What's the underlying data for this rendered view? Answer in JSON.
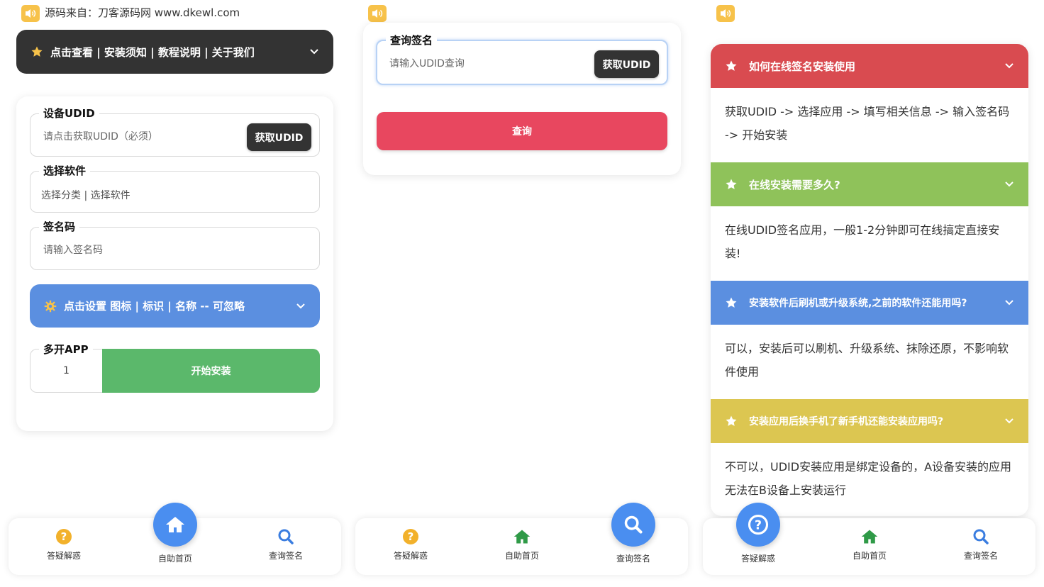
{
  "colors": {
    "dark": "#333333",
    "blue": "#5b8fe0",
    "green": "#5bb86b",
    "pink": "#e8475f",
    "red": "#d94b50",
    "lime": "#8fc25a",
    "yellow": "#dcc651",
    "nav_blue": "#4a8ef0",
    "orange": "#f2b12b"
  },
  "panel1": {
    "notice": "源码来自：刀客源码网 www.dkewl.com",
    "menu_bar": "点击查看 | 安装须知 | 教程说明 | 关于我们",
    "udid": {
      "label": "设备UDID",
      "placeholder": "请点击获取UDID（必须）",
      "button": "获取UDID"
    },
    "software": {
      "label": "选择软件",
      "value": "选择分类 | 选择软件"
    },
    "sign_code": {
      "label": "签名码",
      "placeholder": "请输入签名码"
    },
    "settings_bar": "点击设置 图标 | 标识 | 名称 -- 可忽略",
    "multi_app": {
      "label": "多开APP",
      "value": "1"
    },
    "install_button": "开始安装"
  },
  "panel2": {
    "query": {
      "label": "查询签名",
      "placeholder": "请输入UDID查询",
      "button": "获取UDID"
    },
    "query_button": "查询"
  },
  "panel3": {
    "faq": [
      {
        "question": "如何在线签名安装使用",
        "answer": "获取UDID -> 选择应用 -> 填写相关信息 -> 输入签名码 -> 开始安装"
      },
      {
        "question": "在线安装需要多久?",
        "answer": "在线UDID签名应用，一般1-2分钟即可在线搞定直接安装!"
      },
      {
        "question": "安装软件后刷机或升级系统,之前的软件还能用吗?",
        "answer": "可以，安装后可以刷机、升级系统、抹除还原，不影响软件使用"
      },
      {
        "question": "安装应用后换手机了新手机还能安装应用吗?",
        "answer": "不可以，UDID安装应用是绑定设备的，A设备安装的应用无法在B设备上安装运行"
      }
    ]
  },
  "nav": {
    "faq": "答疑解惑",
    "home": "自助首页",
    "query": "查询签名"
  },
  "icons": [
    "speaker-icon",
    "star-icon",
    "chevron-down-icon",
    "gear-icon",
    "question-icon",
    "home-icon",
    "search-icon"
  ]
}
